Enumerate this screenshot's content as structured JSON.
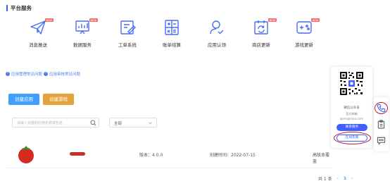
{
  "section": {
    "title": "平台服务"
  },
  "services": [
    {
      "label": "消息推送",
      "icon": "paper-plane-icon",
      "badge": "NEW"
    },
    {
      "label": "数据服务",
      "icon": "data-chart-icon",
      "badge": "NEW"
    },
    {
      "label": "工单系统",
      "icon": "ticket-edit-icon",
      "badge": ""
    },
    {
      "label": "账单结算",
      "icon": "calculator-icon",
      "badge": ""
    },
    {
      "label": "应用认领",
      "icon": "user-check-icon",
      "badge": ""
    },
    {
      "label": "商店更新",
      "icon": "store-update-icon",
      "badge": "NEW"
    },
    {
      "label": "游戏更新",
      "icon": "gamepad-icon",
      "badge": "NEW"
    }
  ],
  "help": {
    "link1": "应用管理常见问题",
    "link2": "应用审核常见问题"
  },
  "actions": {
    "create_app": "创建应用",
    "create_game": "创建游戏"
  },
  "filters": {
    "search_placeholder": "请输入完整的应用名称或包名",
    "status_value": "全部"
  },
  "app_row": {
    "version": "版本：4.0.0",
    "created": "创建时间：2022-07-15",
    "reason": "高版本覆盖"
  },
  "pagination": {
    "total": "共 1 条",
    "current": "1"
  },
  "qr_card": {
    "label": "微信公众号",
    "mailbox_label": "官方邮箱",
    "email": "open@vivo.com",
    "contact": "联系服务",
    "feedback": "在线客服"
  },
  "colors": {
    "brand": "#415fff",
    "primary_button": "#409eff",
    "warning_button": "#e6a23c",
    "link": "#4a7de8",
    "badge": "#f56c6c",
    "highlight_ring": "#c0182b"
  }
}
